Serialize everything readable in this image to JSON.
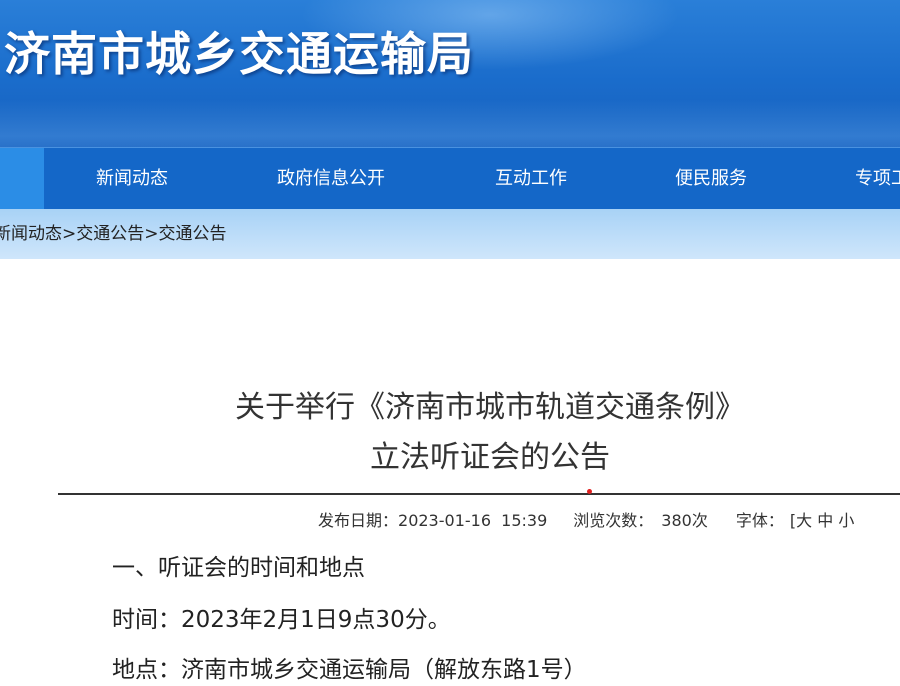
{
  "site": {
    "title": "济南市城乡交通运输局"
  },
  "nav": {
    "items": [
      {
        "label": "新闻动态"
      },
      {
        "label": "政府信息公开"
      },
      {
        "label": "互动工作"
      },
      {
        "label": "便民服务"
      },
      {
        "label": "专项工"
      }
    ]
  },
  "breadcrumb": {
    "items": [
      "新闻动态",
      "交通公告",
      "交通公告"
    ],
    "separator": ">"
  },
  "article": {
    "title_line1": "关于举行《济南市城市轨道交通条例》",
    "title_line2": "立法听证会的公告",
    "meta": {
      "publish_label": "发布日期：",
      "publish_date": "2023-01-16  15:39",
      "views_label": "浏览次数：",
      "views": "380次",
      "font_label": "字体：",
      "font_bracket": "[",
      "font_large": "大",
      "font_medium": "中",
      "font_small": "小"
    },
    "paragraphs": [
      "一、听证会的时间和地点",
      "时间：2023年2月1日9点30分。",
      "地点：济南市城乡交通运输局（解放东路1号）"
    ]
  },
  "colors": {
    "banner": "#1a6ccb",
    "nav": "#1467c8",
    "breadcrumb_bg": "#bfdef8",
    "accent_dot": "#e02020"
  }
}
